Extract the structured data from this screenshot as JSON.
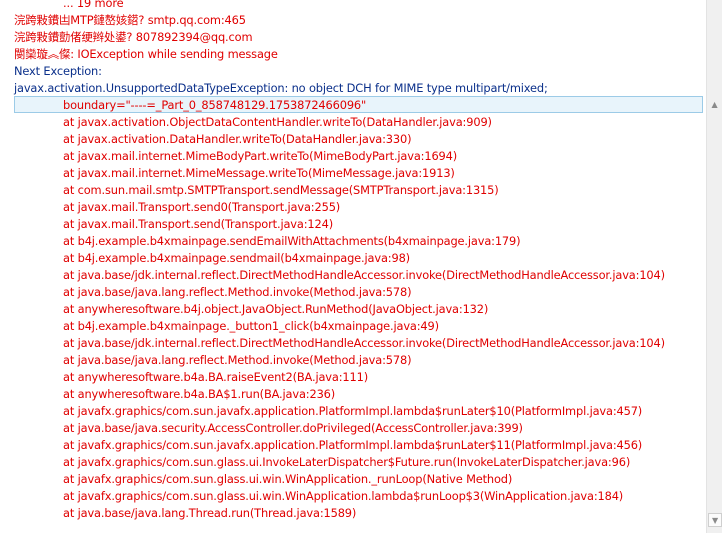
{
  "log": {
    "lines": [
      {
        "text": "... 19 more",
        "indent": 63,
        "color": "red"
      },
      {
        "text": "浣跨敤鐨凷MTP鏈嶅姟鍣? smtp.qq.com:465",
        "indent": 14,
        "color": "red"
      },
      {
        "text": "浣跨敤鐨勯偖绠辫处鍙? 807892394@qq.com",
        "indent": 14,
        "color": "red"
      },
      {
        "text": "閿欒璇︽儏: IOException while sending message",
        "indent": 14,
        "color": "red"
      },
      {
        "text": "Next Exception:",
        "indent": 14,
        "color": "blue"
      },
      {
        "text": "javax.activation.UnsupportedDataTypeException: no object DCH for MIME type multipart/mixed;",
        "indent": 14,
        "color": "blue"
      },
      {
        "text": "boundary=\"----=_Part_0_858748129.1753872466096\"",
        "indent": 63,
        "color": "red",
        "highlight": true
      },
      {
        "text": "at javax.activation.ObjectDataContentHandler.writeTo(DataHandler.java:909)",
        "indent": 63,
        "color": "red"
      },
      {
        "text": "at javax.activation.DataHandler.writeTo(DataHandler.java:330)",
        "indent": 63,
        "color": "red"
      },
      {
        "text": "at javax.mail.internet.MimeBodyPart.writeTo(MimeBodyPart.java:1694)",
        "indent": 63,
        "color": "red"
      },
      {
        "text": "at javax.mail.internet.MimeMessage.writeTo(MimeMessage.java:1913)",
        "indent": 63,
        "color": "red"
      },
      {
        "text": "at com.sun.mail.smtp.SMTPTransport.sendMessage(SMTPTransport.java:1315)",
        "indent": 63,
        "color": "red"
      },
      {
        "text": "at javax.mail.Transport.send0(Transport.java:255)",
        "indent": 63,
        "color": "red"
      },
      {
        "text": "at javax.mail.Transport.send(Transport.java:124)",
        "indent": 63,
        "color": "red"
      },
      {
        "text": "at b4j.example.b4xmainpage.sendEmailWithAttachments(b4xmainpage.java:179)",
        "indent": 63,
        "color": "red"
      },
      {
        "text": "at b4j.example.b4xmainpage.sendmail(b4xmainpage.java:98)",
        "indent": 63,
        "color": "red"
      },
      {
        "text": "at java.base/jdk.internal.reflect.DirectMethodHandleAccessor.invoke(DirectMethodHandleAccessor.java:104)",
        "indent": 63,
        "color": "red"
      },
      {
        "text": "at java.base/java.lang.reflect.Method.invoke(Method.java:578)",
        "indent": 63,
        "color": "red"
      },
      {
        "text": "at anywheresoftware.b4j.object.JavaObject.RunMethod(JavaObject.java:132)",
        "indent": 63,
        "color": "red"
      },
      {
        "text": "at b4j.example.b4xmainpage._button1_click(b4xmainpage.java:49)",
        "indent": 63,
        "color": "red"
      },
      {
        "text": "at java.base/jdk.internal.reflect.DirectMethodHandleAccessor.invoke(DirectMethodHandleAccessor.java:104)",
        "indent": 63,
        "color": "red"
      },
      {
        "text": "at java.base/java.lang.reflect.Method.invoke(Method.java:578)",
        "indent": 63,
        "color": "red"
      },
      {
        "text": "at anywheresoftware.b4a.BA.raiseEvent2(BA.java:111)",
        "indent": 63,
        "color": "red"
      },
      {
        "text": "at anywheresoftware.b4a.BA$1.run(BA.java:236)",
        "indent": 63,
        "color": "red"
      },
      {
        "text": "at javafx.graphics/com.sun.javafx.application.PlatformImpl.lambda$runLater$10(PlatformImpl.java:457)",
        "indent": 63,
        "color": "red"
      },
      {
        "text": "at java.base/java.security.AccessController.doPrivileged(AccessController.java:399)",
        "indent": 63,
        "color": "red"
      },
      {
        "text": "at javafx.graphics/com.sun.javafx.application.PlatformImpl.lambda$runLater$11(PlatformImpl.java:456)",
        "indent": 63,
        "color": "red"
      },
      {
        "text": "at javafx.graphics/com.sun.glass.ui.InvokeLaterDispatcher$Future.run(InvokeLaterDispatcher.java:96)",
        "indent": 63,
        "color": "red"
      },
      {
        "text": "at javafx.graphics/com.sun.glass.ui.win.WinApplication._runLoop(Native Method)",
        "indent": 63,
        "color": "red"
      },
      {
        "text": "at javafx.graphics/com.sun.glass.ui.win.WinApplication.lambda$runLoop$3(WinApplication.java:184)",
        "indent": 63,
        "color": "red"
      },
      {
        "text": "at java.base/java.lang.Thread.run(Thread.java:1589)",
        "indent": 63,
        "color": "red"
      }
    ]
  },
  "scrollbar": {
    "up_icon": "chevron-up-icon",
    "down_icon": "chevron-down-icon"
  }
}
